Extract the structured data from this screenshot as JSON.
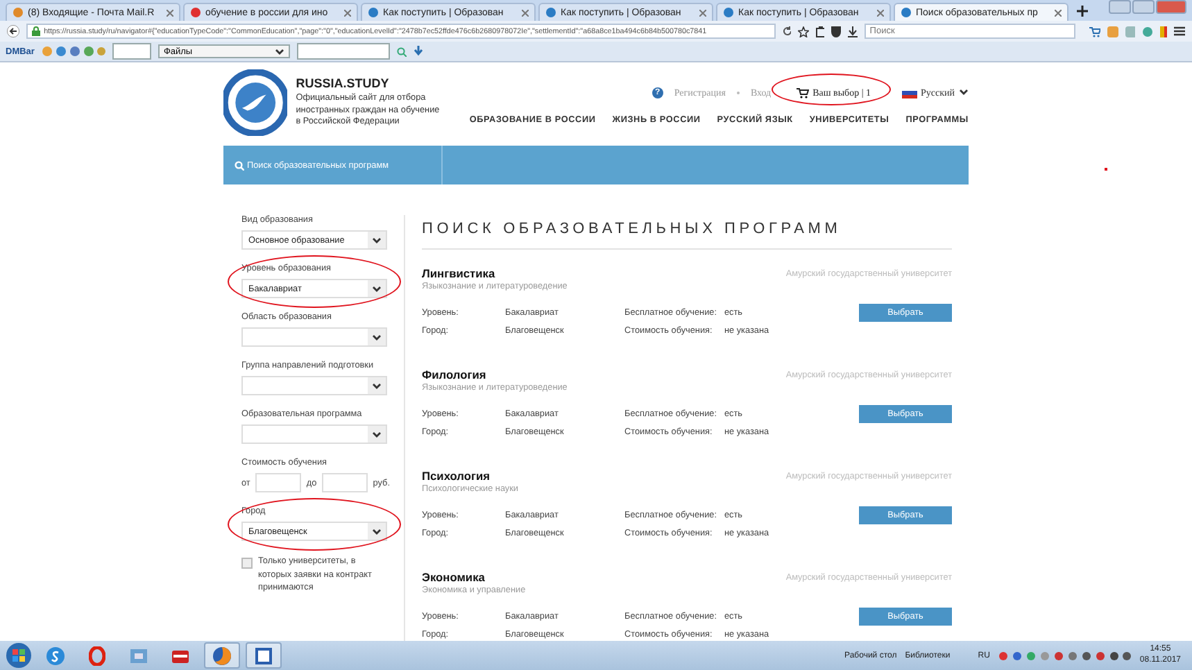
{
  "browser": {
    "tabs": [
      {
        "title": "(8) Входящие - Почта Mail.R",
        "selected": false
      },
      {
        "title": "обучение в россии для ино",
        "selected": false
      },
      {
        "title": "Как поступить | Образован",
        "selected": false
      },
      {
        "title": "Как поступить | Образован",
        "selected": false
      },
      {
        "title": "Как поступить | Образован",
        "selected": false
      },
      {
        "title": "Поиск образовательных пр",
        "selected": true
      }
    ],
    "url": "https://russia.study/ru/navigator#{\"educationTypeCode\":\"CommonEducation\",\"page\":\"0\",\"educationLevelId\":\"2478b7ec52ffde476c6b2680978072Ie\",\"settlementId\":\"a68a8ce1ba494c6b84b500780c7841",
    "search": {
      "placeholder": "Поиск"
    },
    "toolbar": {
      "brand": "DMBar",
      "folder": "Файлы"
    }
  },
  "header": {
    "site_name": "RUSSIA.STUDY",
    "tagline": [
      "Официальный сайт для отбора",
      "иностранных граждан на обучение",
      "в Российской Федерации"
    ],
    "help": "?",
    "links": [
      "Регистрация",
      "Вход"
    ],
    "cart": {
      "label": "Ваш выбор | 1",
      "circled": true
    },
    "language": "Русский",
    "nav": [
      "ОБРАЗОВАНИЕ В РОССИИ",
      "ЖИЗНЬ В РОССИИ",
      "РУССКИЙ ЯЗЫК",
      "УНИВЕРСИТЕТЫ",
      "ПРОГРАММЫ"
    ]
  },
  "search_bar": {
    "label": "Поиск образовательных программ"
  },
  "filters": [
    {
      "kind": "select",
      "label": "Вид образования",
      "value": "Основное образование",
      "circled": false
    },
    {
      "kind": "select",
      "label": "Уровень образования",
      "value": "Бакалавриат",
      "circled": true
    },
    {
      "kind": "select",
      "label": "Область образования",
      "circled": false
    },
    {
      "kind": "select",
      "label": "Группа направлений подготовки",
      "circled": false
    },
    {
      "kind": "select",
      "label": "Образовательная программа",
      "circled": false
    },
    {
      "kind": "range",
      "label": "Стоимость обучения",
      "from": "от",
      "to": "до",
      "unit": "руб.",
      "circled": false
    },
    {
      "kind": "select",
      "label": "Город",
      "value": "Благовещенск",
      "circled": true
    },
    {
      "kind": "checkbox",
      "label": "Только университеты, в которых заявки на контракт принимаются",
      "checked": false,
      "circled": false
    }
  ],
  "results": {
    "title": "ПОИСК ОБРАЗОВАТЕЛЬНЫХ ПРОГРАММ",
    "items": [
      {
        "name": "Лингвистика",
        "field": "Языкознание и литературоведение",
        "university": "Амурский государственный университет",
        "level_label": "Уровень:",
        "level": "Бакалавриат",
        "free_label": "Бесплатное обучение:",
        "free": "есть",
        "city_label": "Город:",
        "city": "Благовещенск",
        "cost_label": "Стоимость обучения:",
        "cost": "не указана",
        "button": "Выбрать"
      },
      {
        "name": "Филология",
        "field": "Языкознание и литературоведение",
        "university": "Амурский государственный университет",
        "level_label": "Уровень:",
        "level": "Бакалавриат",
        "free_label": "Бесплатное обучение:",
        "free": "есть",
        "city_label": "Город:",
        "city": "Благовещенск",
        "cost_label": "Стоимость обучения:",
        "cost": "не указана",
        "button": "Выбрать"
      },
      {
        "name": "Психология",
        "field": "Психологические науки",
        "university": "Амурский государственный университет",
        "level_label": "Уровень:",
        "level": "Бакалавриат",
        "free_label": "Бесплатное обучение:",
        "free": "есть",
        "city_label": "Город:",
        "city": "Благовещенск",
        "cost_label": "Стоимость обучения:",
        "cost": "не указана",
        "button": "Выбрать"
      },
      {
        "name": "Экономика",
        "field": "Экономика и управление",
        "university": "Амурский государственный университет",
        "level_label": "Уровень:",
        "level": "Бакалавриат",
        "free_label": "Бесплатное обучение:",
        "free": "есть",
        "city_label": "Город:",
        "city": "Благовещенск",
        "cost_label": "Стоимость обучения:",
        "cost": "не указана",
        "button": "Выбрать"
      }
    ]
  },
  "taskbar": {
    "desktop": "Рабочий стол",
    "libraries": "Библиотеки",
    "lang": "RU",
    "time": "14:55",
    "date": "08.11.2017"
  }
}
